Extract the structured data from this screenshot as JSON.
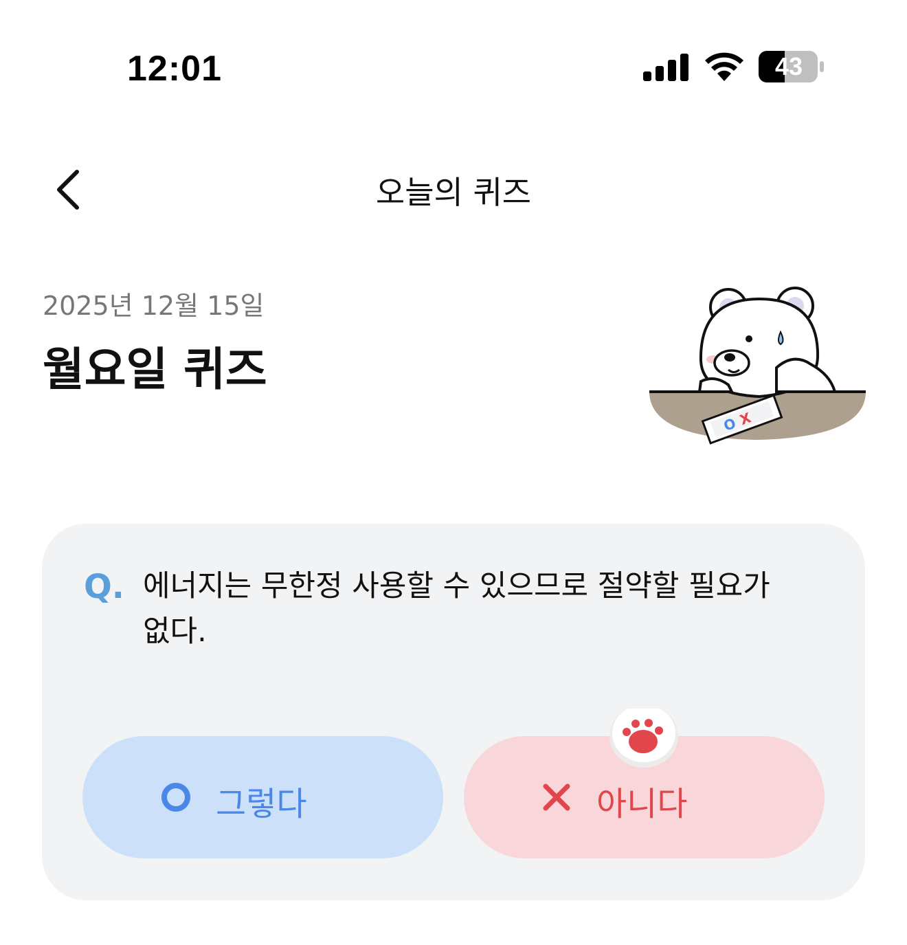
{
  "status_bar": {
    "time": "12:01",
    "battery_level": "43",
    "icons": [
      "signal-icon",
      "wifi-icon",
      "battery-icon"
    ]
  },
  "nav": {
    "back_icon": "chevron-left-icon",
    "title": "오늘의 퀴즈"
  },
  "header": {
    "date": "2025년 12월 15일",
    "title": "월요일 퀴즈",
    "illustration": "bear-mascot-with-ox-card"
  },
  "quiz": {
    "q_prefix": "Q.",
    "question": "에너지는 무한정 사용할 수 있으므로 절약할 필요가 없다.",
    "answers": [
      {
        "icon": "circle-o-icon",
        "label": "그렇다",
        "color": "#4b87e6",
        "background": "#cde0fa"
      },
      {
        "icon": "x-icon",
        "label": "아니다",
        "color": "#e0464b",
        "background": "#f8d6d9"
      }
    ],
    "selected_marker_icon": "paw-icon"
  },
  "colors": {
    "q_mark": "#5a9fd9",
    "card_background": "#f2f3f5",
    "date_text": "#777777"
  }
}
